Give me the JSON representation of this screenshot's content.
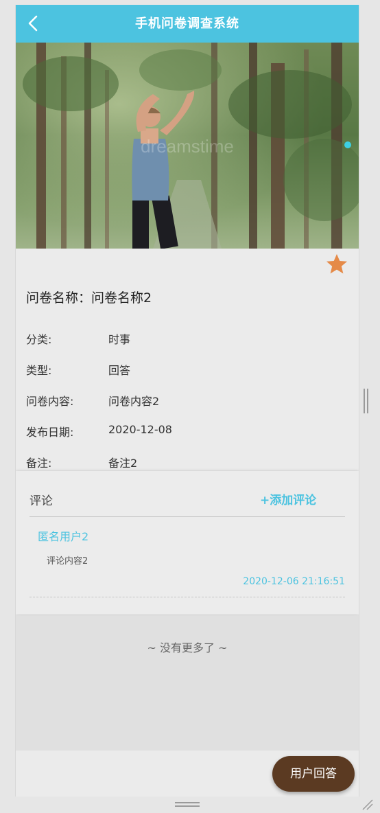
{
  "header": {
    "title": "手机问卷调查系统",
    "back_icon": "chevron-left-icon"
  },
  "banner": {
    "description_icon": "carousel-image",
    "watermark": "dreamstime",
    "active_dot_color": "#3dd0e3"
  },
  "favorite": {
    "icon": "star-icon",
    "color": "#e58a48"
  },
  "survey": {
    "name_label": "问卷名称：",
    "name_value": "问卷名称2",
    "rows": [
      {
        "label": "分类:",
        "value": "时事"
      },
      {
        "label": "类型:",
        "value": "回答"
      },
      {
        "label": "问卷内容:",
        "value": "问卷内容2"
      },
      {
        "label": "发布日期:",
        "value": "2020-12-08"
      },
      {
        "label": "备注:",
        "value": "备注2"
      }
    ]
  },
  "comments": {
    "heading": "评论",
    "add_label": "+添加评论",
    "items": [
      {
        "user": "匿名用户2",
        "content": "评论内容2",
        "time": "2020-12-06 21:16:51"
      }
    ]
  },
  "footer": {
    "no_more": "~ 没有更多了 ~",
    "answer_button": "用户回答"
  },
  "colors": {
    "accent": "#4cc3e0",
    "answer_button": "#5b3a22"
  }
}
